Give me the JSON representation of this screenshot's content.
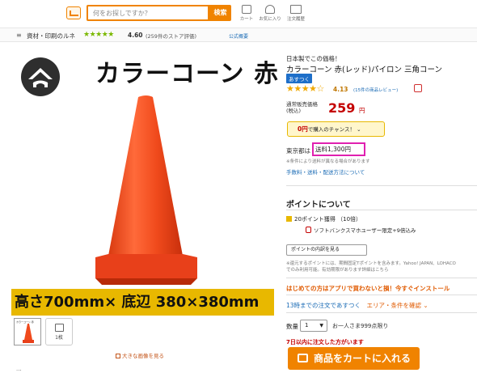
{
  "header": {
    "search_placeholder": "何をお探しですか？",
    "search_button": "検索",
    "icons": [
      {
        "name": "cart-icon",
        "label": "カート"
      },
      {
        "name": "heart-icon",
        "label": "お気に入り"
      },
      {
        "name": "truck-icon",
        "label": "注文履歴"
      }
    ]
  },
  "store": {
    "breadcrumb": "資材・印刷のルネ",
    "stars": "★★★★★",
    "rating": "4.60",
    "rating_meta": "(259件のストア評価)",
    "notice_link": "公式概要"
  },
  "image": {
    "product_title": "カラーコーン 赤",
    "dimensions": "高さ700mm× 底辺 380×380mm",
    "thumb_label": "カラーコーン 赤",
    "thumb_count": "1枚",
    "view_large": "大きな画像を見る",
    "bottom_label": "..."
  },
  "product": {
    "slogan": "日本製でこの価格！",
    "name": "カラーコーン 赤(レッド)パイロン 三角コーン",
    "badge": "あすつく",
    "stars": "★★★★☆",
    "rating": "4.13",
    "review_count": "(15件の商品レビュー)",
    "price_label_1": "通常販売価格",
    "price_label_2": "(税込)",
    "price": "259",
    "price_unit": "円",
    "chance_bold": "0円",
    "chance_text": "で購入のチャンス！",
    "chance_chevron": "⌄",
    "ship_prefix": "東京都は",
    "ship_fee": "送料1,300円",
    "ship_note": "※条件により送料が異なる場合があります",
    "fee_link": "手数料・送料・配送方法について"
  },
  "points": {
    "heading": "ポイントについて",
    "earn": "20ポイント獲得 （10倍）",
    "softbank": "ソフトバンクスマホユーザー限定+9倍込み",
    "breakdown_select": "ポイントの内訳を見る",
    "fine_print_1": "※還元するポイントには、期間固定Tポイントを含みます。Yahoo! JAPAN、LOHACO",
    "fine_print_2": "でのみ利用可能。有効期限があります詳細はこちら"
  },
  "purchase": {
    "promo": "はじめての方はアプリで買わないと損！今すぐインストール",
    "delivery_main": "13時までの注文であすつく",
    "delivery_area": "エリア・条件を確認 ⌄",
    "qty_label": "数量",
    "qty_value": "1",
    "qty_limit": "お一人さま999点限り",
    "order_notice": "7日以内に注文した方がいます",
    "cart_button": "商品をカートに入れる"
  }
}
